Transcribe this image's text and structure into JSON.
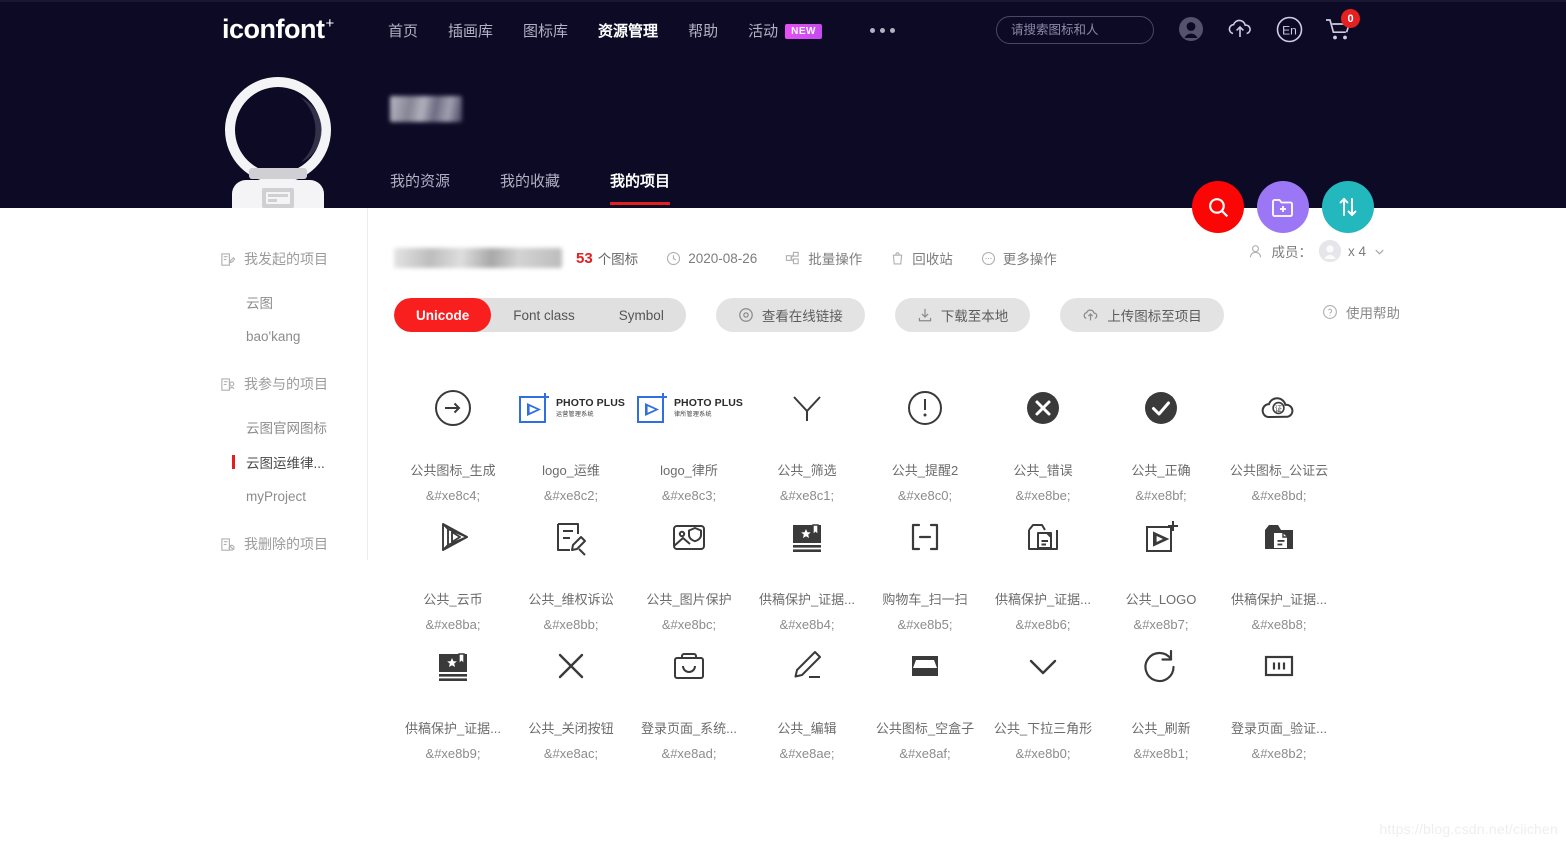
{
  "brand": {
    "name": "iconfont",
    "sup": "+"
  },
  "nav": {
    "links": [
      {
        "label": "首页",
        "active": false
      },
      {
        "label": "插画库",
        "active": false
      },
      {
        "label": "图标库",
        "active": false
      },
      {
        "label": "资源管理",
        "active": true
      },
      {
        "label": "帮助",
        "active": false
      },
      {
        "label": "活动",
        "active": false,
        "badge": "NEW"
      }
    ],
    "more_icon": "more-dots-icon"
  },
  "search": {
    "placeholder": "请搜索图标和人",
    "value": "",
    "icon": "search-icon"
  },
  "header_icons": [
    {
      "name": "user-avatar-icon"
    },
    {
      "name": "upload-cloud-icon"
    },
    {
      "name": "language-en-icon",
      "label": "En"
    },
    {
      "name": "shopping-cart-icon",
      "badge": "0"
    }
  ],
  "profile": {
    "avatar": "astronaut-helmet-avatar",
    "name_redacted": "",
    "tabs": [
      {
        "label": "我的资源",
        "active": false
      },
      {
        "label": "我的收藏",
        "active": false
      },
      {
        "label": "我的项目",
        "active": true
      }
    ]
  },
  "fabs": [
    {
      "name": "search-fab",
      "icon": "search-icon",
      "color": "#fb0505"
    },
    {
      "name": "new-project-fab",
      "icon": "folder-plus-icon",
      "color": "#9c77f5"
    },
    {
      "name": "sort-fab",
      "icon": "sort-updown-icon",
      "color": "#22b8bd"
    }
  ],
  "sidebar": {
    "groups": [
      {
        "label": "我发起的项目",
        "icon": "project-created-icon",
        "items": [
          {
            "label": "云图",
            "active": false
          },
          {
            "label": "bao'kang",
            "active": false
          }
        ]
      },
      {
        "label": "我参与的项目",
        "icon": "project-joined-icon",
        "items": [
          {
            "label": "云图官网图标",
            "active": false
          },
          {
            "label": "云图运维律...",
            "active": true
          },
          {
            "label": "myProject",
            "active": false
          }
        ]
      },
      {
        "label": "我删除的项目",
        "icon": "project-deleted-icon",
        "items": []
      }
    ]
  },
  "toolbar": {
    "project_title_redacted": "",
    "icon_count": "53",
    "icon_count_unit": "个图标",
    "date": "2020-08-26",
    "date_icon": "clock-icon",
    "batch_label": "批量操作",
    "batch_icon": "batch-icon",
    "recycle_label": "回收站",
    "recycle_icon": "trash-icon",
    "more_label": "更多操作",
    "more_icon": "ellipsis-circle-icon",
    "members_label": "成员：",
    "members_icon": "members-icon",
    "members_count": "x 4",
    "members_chevron": "chevron-down-icon"
  },
  "actionbar": {
    "segments": [
      {
        "label": "Unicode",
        "active": true
      },
      {
        "label": "Font class",
        "active": false
      },
      {
        "label": "Symbol",
        "active": false
      }
    ],
    "buttons": [
      {
        "label": "查看在线链接",
        "icon": "link-eye-icon"
      },
      {
        "label": "下载至本地",
        "icon": "download-icon"
      },
      {
        "label": "上传图标至项目",
        "icon": "upload-icon"
      }
    ],
    "help_label": "使用帮助",
    "help_icon": "question-circle-icon"
  },
  "icons": [
    {
      "art": "arrow-right-circle-icon",
      "name": "公共图标_生成",
      "code": "&#xe8c4;"
    },
    {
      "art": "photo-plus-logo",
      "logo_title": "PHOTO PLUS",
      "logo_sub": "运营管理系统",
      "name": "logo_运维",
      "code": "&#xe8c2;"
    },
    {
      "art": "photo-plus-logo",
      "logo_title": "PHOTO PLUS",
      "logo_sub": "律所管理系统",
      "name": "logo_律所",
      "code": "&#xe8c3;"
    },
    {
      "art": "filter-funnel-icon",
      "name": "公共_筛选",
      "code": "&#xe8c1;"
    },
    {
      "art": "exclamation-circle-icon",
      "name": "公共_提醒2",
      "code": "&#xe8c0;"
    },
    {
      "art": "close-circle-filled-icon",
      "name": "公共_错误",
      "code": "&#xe8be;"
    },
    {
      "art": "check-circle-filled-icon",
      "name": "公共_正确",
      "code": "&#xe8bf;"
    },
    {
      "art": "cloud-notary-icon",
      "name": "公共图标_公证云",
      "code": "&#xe8bd;"
    },
    {
      "art": "play-3d-icon",
      "name": "公共_云币",
      "code": "&#xe8ba;"
    },
    {
      "art": "doc-edit-icon",
      "name": "公共_维权诉讼",
      "code": "&#xe8bb;"
    },
    {
      "art": "image-shield-icon",
      "name": "公共_图片保护",
      "code": "&#xe8bc;"
    },
    {
      "art": "book-star-filled-icon",
      "name": "供稿保护_证据...",
      "code": "&#xe8b4;"
    },
    {
      "art": "bracket-minus-icon",
      "name": "购物车_扫一扫",
      "code": "&#xe8b5;"
    },
    {
      "art": "folder-doc-icon",
      "name": "供稿保护_证据...",
      "code": "&#xe8b6;"
    },
    {
      "art": "logo-play-plus-icon",
      "name": "公共_LOGO",
      "code": "&#xe8b7;"
    },
    {
      "art": "folder-doc-filled-icon",
      "name": "供稿保护_证据...",
      "code": "&#xe8b8;"
    },
    {
      "art": "book-star-filled-icon",
      "name": "供稿保护_证据...",
      "code": "&#xe8b9;"
    },
    {
      "art": "close-x-icon",
      "name": "公共_关闭按钮",
      "code": "&#xe8ac;"
    },
    {
      "art": "briefcase-icon",
      "name": "登录页面_系统...",
      "code": "&#xe8ad;"
    },
    {
      "art": "pencil-edit-icon",
      "name": "公共_编辑",
      "code": "&#xe8ae;"
    },
    {
      "art": "empty-box-filled-icon",
      "name": "公共图标_空盒子",
      "code": "&#xe8af;"
    },
    {
      "art": "chevron-down-icon",
      "name": "公共_下拉三角形",
      "code": "&#xe8b0;"
    },
    {
      "art": "refresh-icon",
      "name": "公共_刷新",
      "code": "&#xe8b1;"
    },
    {
      "art": "captcha-icon",
      "name": "登录页面_验证...",
      "code": "&#xe8b2;"
    }
  ],
  "watermark": "https://blog.csdn.net/ciichen"
}
